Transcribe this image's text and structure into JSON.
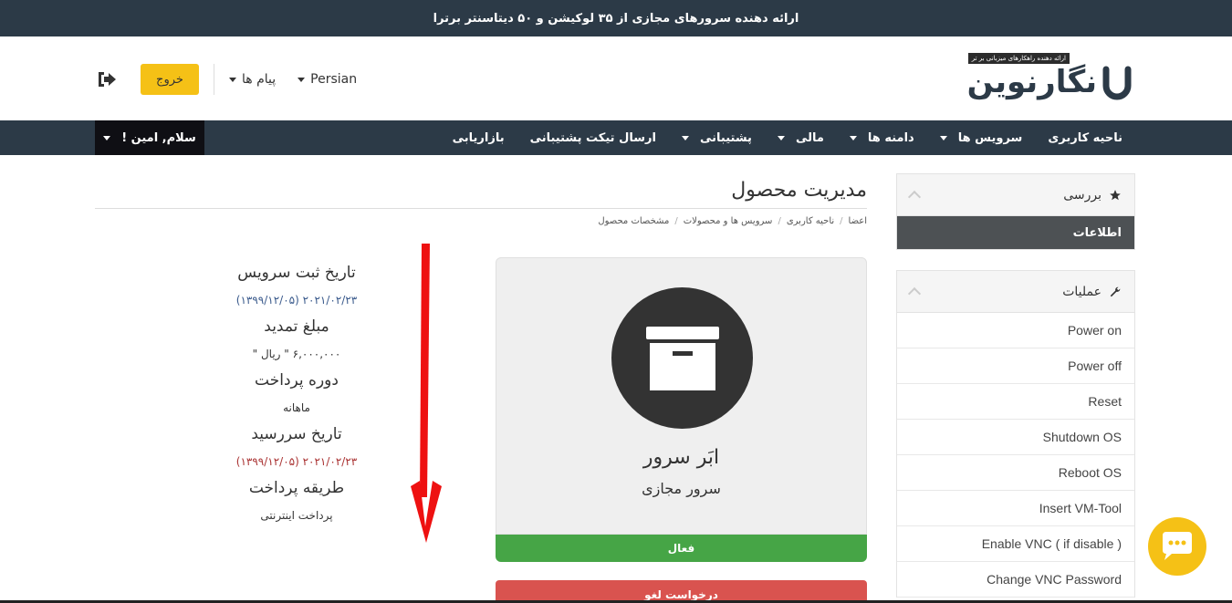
{
  "topbar": {
    "text": "ارائه دهنده سرورهای مجازی از ۳۵ لوکیشن و ۵۰ دیتاسنتر برترا"
  },
  "header": {
    "logo_tag": "ارائه دهنده راهکارهای میزبانی بر تر",
    "logo_text": "نگارنوین",
    "logout_label": "خروج",
    "messages_label": "پیام ها",
    "language_label": "Persian"
  },
  "nav": {
    "items": [
      {
        "label": "ناحیه کاربری",
        "dropdown": false
      },
      {
        "label": "سرویس ها",
        "dropdown": true
      },
      {
        "label": "دامنه ها",
        "dropdown": true
      },
      {
        "label": "مالی",
        "dropdown": true
      },
      {
        "label": "پشتیبانی",
        "dropdown": true
      },
      {
        "label": "ارسال تیکت پشتیبانی",
        "dropdown": false
      },
      {
        "label": "بازاریابی",
        "dropdown": false
      }
    ],
    "greeting": "سلام, امین !"
  },
  "sidebar": {
    "overview_title": "بررسی",
    "overview_active": "اطلاعات",
    "ops_title": "عملیات",
    "ops_items": [
      "Power on",
      "Power off",
      "Reset",
      "Shutdown OS",
      "Reboot OS",
      "Insert VM-Tool",
      "Enable VNC ( if disable )",
      "Change VNC Password"
    ]
  },
  "main": {
    "title": "مدیریت محصول",
    "breadcrumb": [
      "اعضا",
      "ناحیه کاربری",
      "سرویس ها و محصولات",
      "مشخصات محصول"
    ],
    "product_name": "ابَر سرور",
    "product_sub": "سرور مجازی",
    "status": "فعال",
    "cancel": "درخواست لغو"
  },
  "info": {
    "reg_label": "تاریخ ثبت سرویس",
    "reg_value": "۲۰۲۱/۰۲/۲۳ (۱۳۹۹/۱۲/۰۵)",
    "amount_label": "مبلغ تمدید",
    "amount_value": "۶,۰۰۰,۰۰۰ \" ریال \"",
    "period_label": "دوره پرداخت",
    "period_value": "ماهانه",
    "due_label": "تاریخ سررسید",
    "due_value": "۲۰۲۱/۰۲/۲۳ (۱۳۹۹/۱۲/۰۵)",
    "method_label": "طریقه پرداخت",
    "method_value": "پرداخت اینترنتی"
  },
  "colors": {
    "dark_nav": "#2c3a47",
    "accent_yellow": "#f5c116",
    "status_green": "#46a546",
    "cancel_red": "#d9534f",
    "arrow_red": "#ee1111"
  }
}
